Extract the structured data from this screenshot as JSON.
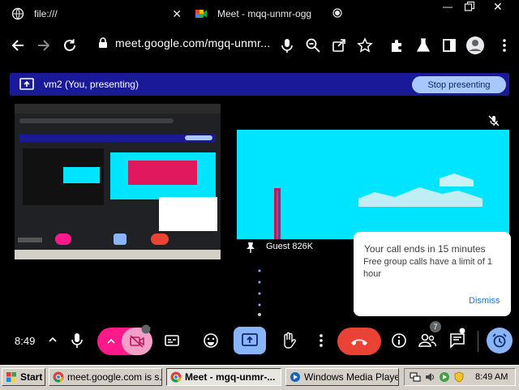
{
  "browser": {
    "tabs": [
      {
        "title": "file:///"
      },
      {
        "title": "Meet - mqq-unmr-ogg"
      }
    ],
    "url": "meet.google.com/mgq-unmr..."
  },
  "banner": {
    "text": "vm2 (You, presenting)",
    "stop_label": "Stop presenting",
    "color": "#1a1a99"
  },
  "participant": {
    "name": "Guest 826K"
  },
  "toast": {
    "title": "Your call ends in 15 minutes",
    "body": "Free group calls have a limit of 1 hour",
    "dismiss_label": "Dismiss"
  },
  "controls": {
    "time": "8:49",
    "people_count": "7",
    "end_call_color": "#ea4335",
    "camera_color": "#ff1a8c"
  },
  "taskbar": {
    "start_label": "Start",
    "items": [
      {
        "label": "meet.google.com is s..."
      },
      {
        "label": "Meet - mgq-unmr-..."
      },
      {
        "label": "Windows Media Player"
      }
    ],
    "clock": "8:49 AM"
  }
}
